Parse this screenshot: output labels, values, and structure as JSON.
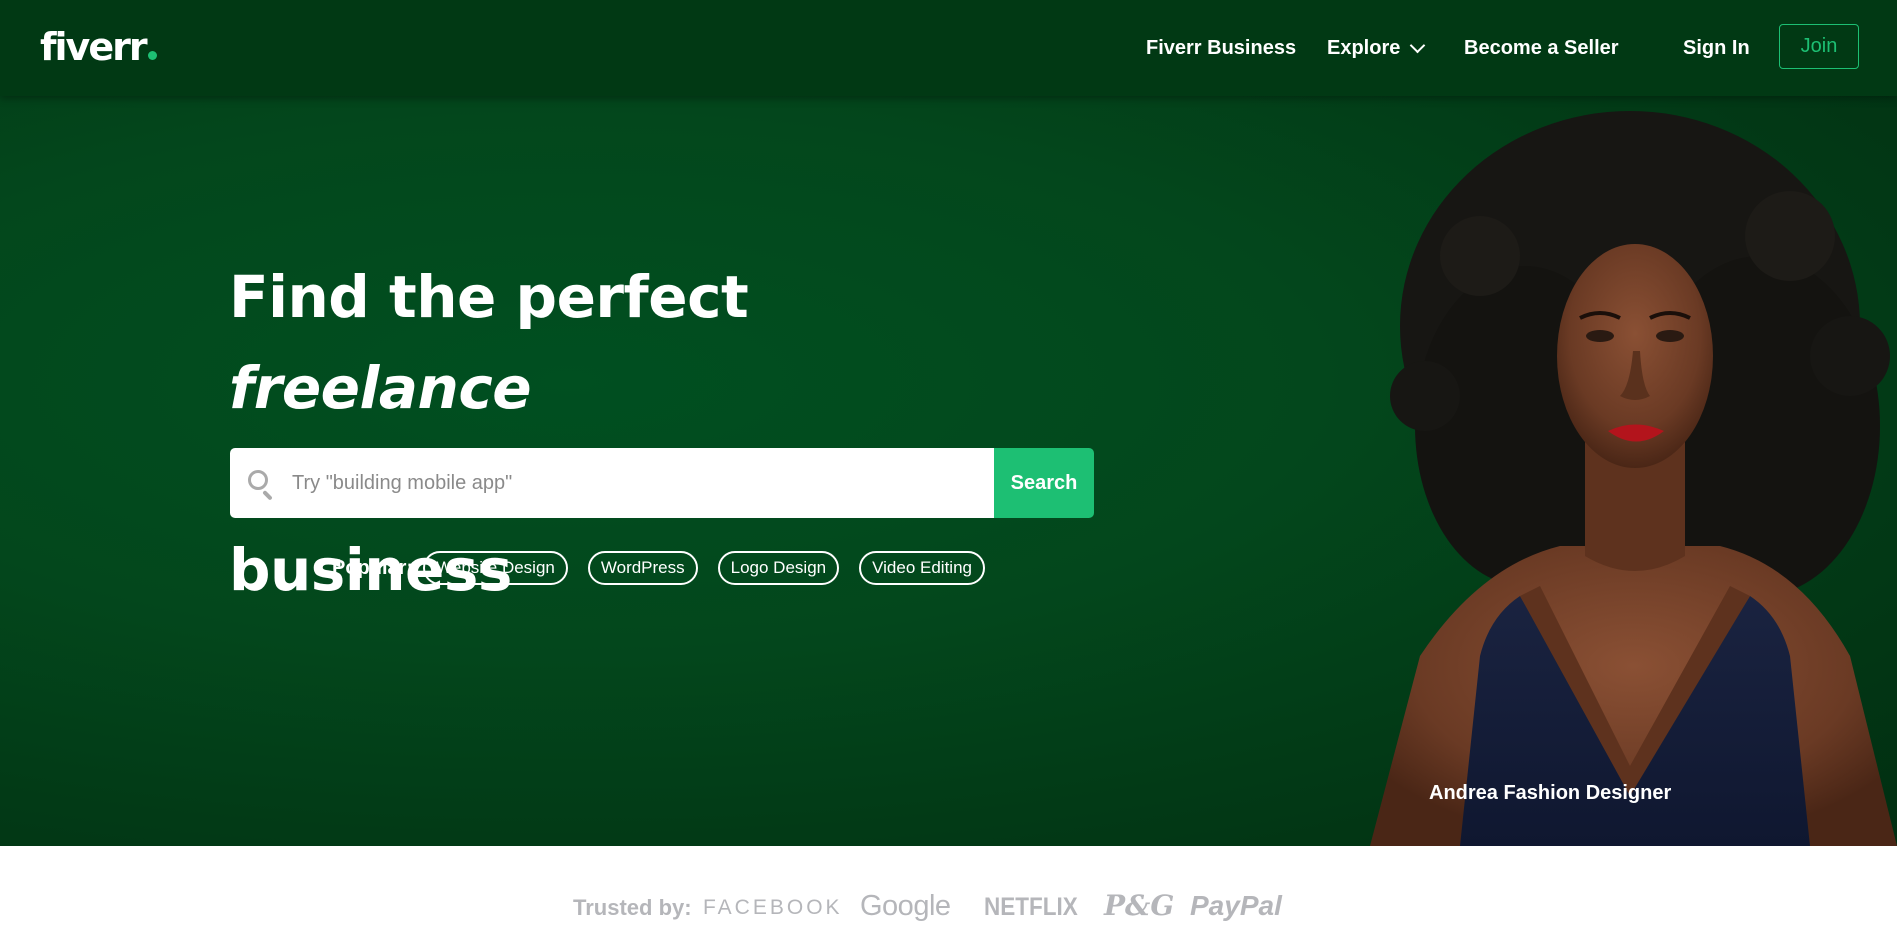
{
  "brand": {
    "logo_text": "fiverr",
    "accent": "#1dbf73",
    "hero_bg": "#003912"
  },
  "nav": {
    "business": "Fiverr Business",
    "explore": "Explore",
    "become_seller": "Become a Seller",
    "sign_in": "Sign In",
    "join": "Join"
  },
  "hero": {
    "headline_part1": "Find the perfect ",
    "headline_em": "freelance",
    "headline_part2": "services for your business",
    "search_placeholder": "Try \"building mobile app\"",
    "search_button": "Search",
    "popular_label": "Popular:",
    "popular_tags": [
      "Website Design",
      "WordPress",
      "Logo Design",
      "Video Editing"
    ],
    "caption": "Andrea Fashion Designer"
  },
  "trusted": {
    "label": "Trusted by:",
    "brands": [
      "FACEBOOK",
      "Google",
      "NETFLIX",
      "P&G",
      "PayPal"
    ]
  }
}
